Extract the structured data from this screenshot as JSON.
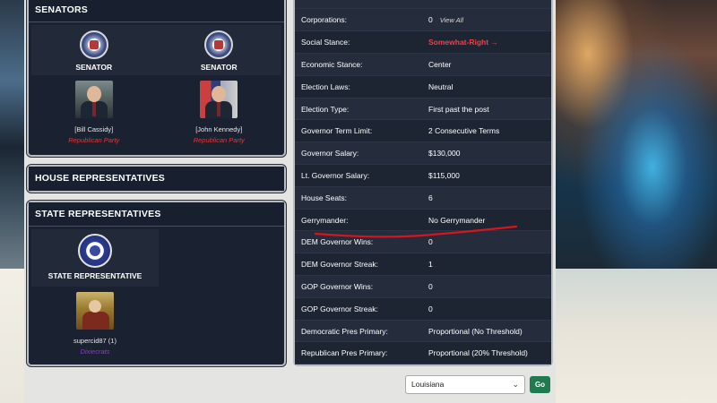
{
  "senators": {
    "header": "SENATORS",
    "office_title": "SENATOR",
    "people": [
      {
        "name": "[Bill Cassidy]",
        "party": "Republican Party"
      },
      {
        "name": "[John Kennedy]",
        "party": "Republican Party"
      }
    ]
  },
  "house": {
    "header": "HOUSE REPRESENTATIVES"
  },
  "state_reps": {
    "header": "STATE REPRESENTATIVES",
    "office_title": "STATE REPRESENTATIVE",
    "person": {
      "name": "supercid87 (1)",
      "party": "Dixiecrats"
    }
  },
  "info": {
    "rows": [
      {
        "key": "Corporations:",
        "value": "0",
        "extra": "View All"
      },
      {
        "key": "Social Stance:",
        "value": "Somewhat-Right →"
      },
      {
        "key": "Economic Stance:",
        "value": "Center"
      },
      {
        "key": "Election Laws:",
        "value": "Neutral"
      },
      {
        "key": "Election Type:",
        "value": "First past the post"
      },
      {
        "key": "Governor Term Limit:",
        "value": "2 Consecutive Terms"
      },
      {
        "key": "Governor Salary:",
        "value": "$130,000"
      },
      {
        "key": "Lt. Governor Salary:",
        "value": "$115,000"
      },
      {
        "key": "House Seats:",
        "value": "6"
      },
      {
        "key": "Gerrymander:",
        "value": "No Gerrymander"
      },
      {
        "key": "DEM Governor Wins:",
        "value": "0"
      },
      {
        "key": "DEM Governor Streak:",
        "value": "1"
      },
      {
        "key": "GOP Governor Wins:",
        "value": "0"
      },
      {
        "key": "GOP Governor Streak:",
        "value": "0"
      },
      {
        "key": "Democratic Pres Primary:",
        "value": "Proportional (No Threshold)"
      },
      {
        "key": "Republican Pres Primary:",
        "value": "Proportional (20% Threshold)"
      }
    ]
  },
  "footer": {
    "state_select_value": "Louisiana",
    "go_label": "Go"
  },
  "colors": {
    "panel_bg": "#1a2130",
    "party_red": "#e03a3a",
    "dixiecrat_purple": "#8b3fc2",
    "go_green": "#1e7a4f",
    "annotation_red": "#d8141c"
  }
}
